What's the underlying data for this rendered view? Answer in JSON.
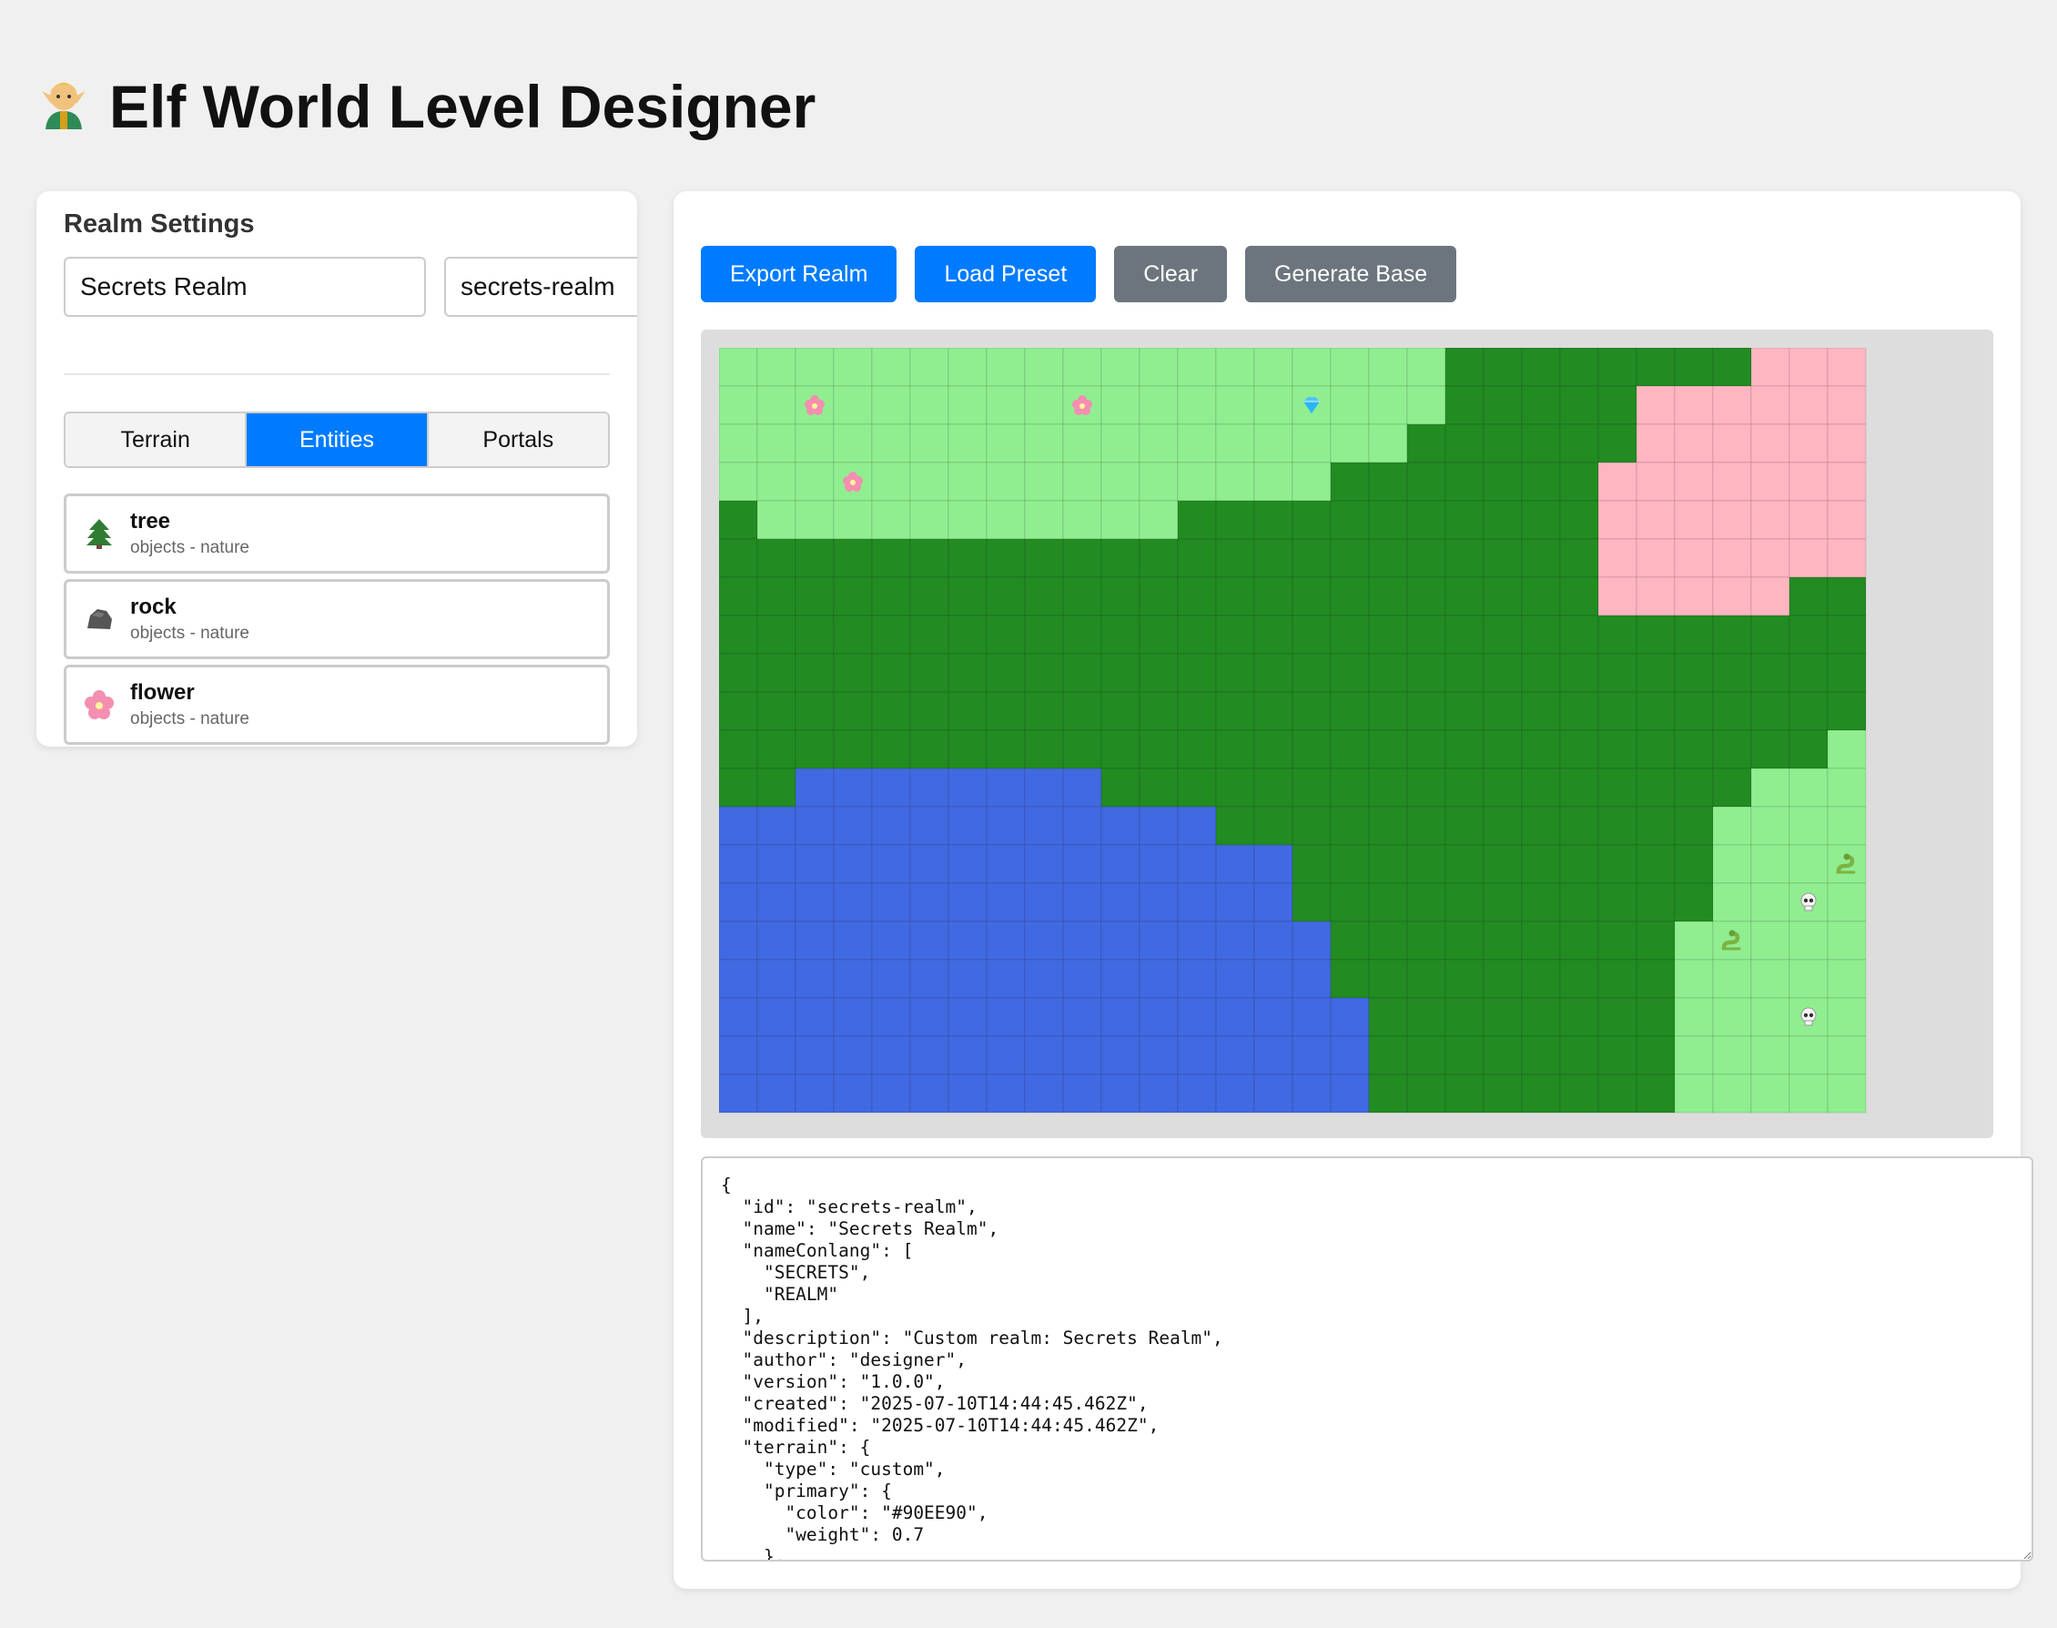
{
  "header": {
    "icon": "elf-icon",
    "title": "Elf World Level Designer"
  },
  "settings": {
    "title": "Realm Settings",
    "realm_name": "Secrets Realm",
    "realm_id": "secrets-realm",
    "tabs": [
      {
        "label": "Terrain",
        "active": false
      },
      {
        "label": "Entities",
        "active": true
      },
      {
        "label": "Portals",
        "active": false
      }
    ],
    "entities": [
      {
        "name": "tree",
        "category": "objects - nature",
        "icon": "tree-icon"
      },
      {
        "name": "rock",
        "category": "objects - nature",
        "icon": "rock-icon"
      },
      {
        "name": "flower",
        "category": "objects - nature",
        "icon": "flower-icon"
      }
    ]
  },
  "toolbar": {
    "export_label": "Export Realm",
    "load_label": "Load Preset",
    "clear_label": "Clear",
    "generate_label": "Generate Base"
  },
  "map": {
    "columns": 30,
    "rows": 20,
    "palette": {
      "L": "#90EE90",
      "F": "#228B22",
      "P": "#FFB6C1",
      "W": "#4169E1"
    },
    "grid": [
      "LLLLLLLLLLLLLLLLLLLFFFFFFFFPPP",
      "LLLLLLLLLLLLLLLLLLLFFFFFPPPPPP",
      "LLLLLLLLLLLLLLLLLLFFFFFFPPPPPP",
      "LLLLLLLLLLLLLLLLFFFFFFFPPPPPPP",
      "FLLLLLLLLLLLFFFFFFFFFFFPPPPPPP",
      "FFFFFFFFFFFFFFFFFFFFFFFPPPPPPP",
      "FFFFFFFFFFFFFFFFFFFFFFFPPPPPFF",
      "FFFFFFFFFFFFFFFFFFFFFFFFFFFFFF",
      "FFFFFFFFFFFFFFFFFFFFFFFFFFFFFF",
      "FFFFFFFFFFFFFFFFFFFFFFFFFFFFFF",
      "FFFFFFFFFFFFFFFFFFFFFFFFFFFFFL",
      "FFWWWWWWWWFFFFFFFFFFFFFFFFFLLL",
      "WWWWWWWWWWWWWFFFFFFFFFFFFFLLLL",
      "WWWWWWWWWWWWWWWFFFFFFFFFFFLLLL",
      "WWWWWWWWWWWWWWWFFFFFFFFFFFLLLL",
      "WWWWWWWWWWWWWWWWFFFFFFFFFLLLLL",
      "WWWWWWWWWWWWWWWWFFFFFFFFFLLLLL",
      "WWWWWWWWWWWWWWWWWFFFFFFFFLLLLL",
      "WWWWWWWWWWWWWWWWWFFFFFFFFLLLLL",
      "WWWWWWWWWWWWWWWWWFFFFFFFFLLLLL"
    ],
    "entities": [
      {
        "type": "flower",
        "col": 2,
        "row": 1
      },
      {
        "type": "flower",
        "col": 9,
        "row": 1
      },
      {
        "type": "gem",
        "col": 15,
        "row": 1
      },
      {
        "type": "flower",
        "col": 3,
        "row": 3
      },
      {
        "type": "snake",
        "col": 29,
        "row": 13
      },
      {
        "type": "skull",
        "col": 28,
        "row": 14
      },
      {
        "type": "snake",
        "col": 26,
        "row": 15
      },
      {
        "type": "skull",
        "col": 28,
        "row": 17
      }
    ]
  },
  "json_output": "{\n  \"id\": \"secrets-realm\",\n  \"name\": \"Secrets Realm\",\n  \"nameConlang\": [\n    \"SECRETS\",\n    \"REALM\"\n  ],\n  \"description\": \"Custom realm: Secrets Realm\",\n  \"author\": \"designer\",\n  \"version\": \"1.0.0\",\n  \"created\": \"2025-07-10T14:44:45.462Z\",\n  \"modified\": \"2025-07-10T14:44:45.462Z\",\n  \"terrain\": {\n    \"type\": \"custom\",\n    \"primary\": {\n      \"color\": \"#90EE90\",\n      \"weight\": 0.7\n    },"
}
